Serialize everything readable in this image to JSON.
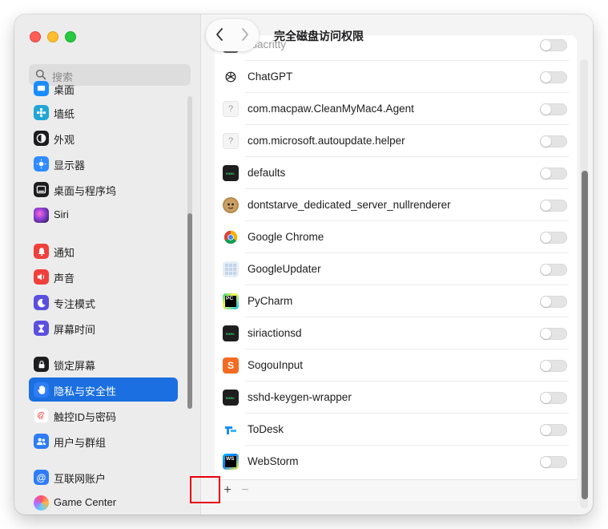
{
  "window": {
    "title": "完全磁盘访问权限"
  },
  "search": {
    "placeholder": "搜索"
  },
  "sidebar": {
    "items": [
      {
        "label": "桌面",
        "icon": "desktop-icon",
        "color": "#1a8cff"
      },
      {
        "label": "墙纸",
        "icon": "wallpaper-icon",
        "color": "#22a6d6"
      },
      {
        "label": "外观",
        "icon": "appearance-icon",
        "color": "#1d1d1f"
      },
      {
        "label": "显示器",
        "icon": "display-icon",
        "color": "#2f8bff"
      },
      {
        "label": "桌面与程序坞",
        "icon": "dock-icon",
        "color": "#1d1d1f"
      },
      {
        "label": "Siri",
        "icon": "siri-icon",
        "color": "#8a3ed6"
      },
      {
        "label": "通知",
        "icon": "bell-icon",
        "color": "#f0403b"
      },
      {
        "label": "声音",
        "icon": "sound-icon",
        "color": "#f0403b"
      },
      {
        "label": "专注模式",
        "icon": "moon-icon",
        "color": "#5b4fe0"
      },
      {
        "label": "屏幕时间",
        "icon": "hourglass-icon",
        "color": "#5b4fe0"
      },
      {
        "label": "锁定屏幕",
        "icon": "lock-screen-icon",
        "color": "#1d1d1f"
      },
      {
        "label": "隐私与安全性",
        "icon": "hand-icon",
        "color": "#2e7cf6"
      },
      {
        "label": "触控ID与密码",
        "icon": "fingerprint-icon",
        "color": "#ffffff"
      },
      {
        "label": "用户与群组",
        "icon": "users-icon",
        "color": "#2e7cf6"
      },
      {
        "label": "互联网账户",
        "icon": "at-icon",
        "color": "#2e7cf6"
      },
      {
        "label": "Game Center",
        "icon": "game-center-icon",
        "color": "#ff6f61"
      }
    ],
    "selected_index": 11
  },
  "apps": [
    {
      "name": "Alacritty",
      "icon": "alacritty-icon",
      "color": "#5c5c5c",
      "enabled": false
    },
    {
      "name": "ChatGPT",
      "icon": "chatgpt-icon",
      "color": "#ffffff",
      "enabled": false
    },
    {
      "name": "com.macpaw.CleanMyMac4.Agent",
      "icon": "generic-file-icon",
      "color": "#f4f4f4",
      "enabled": false
    },
    {
      "name": "com.microsoft.autoupdate.helper",
      "icon": "generic-file-icon",
      "color": "#f4f4f4",
      "enabled": false
    },
    {
      "name": "defaults",
      "icon": "terminal-icon",
      "color": "#1e1e1e",
      "enabled": false
    },
    {
      "name": "dontstarve_dedicated_server_nullrenderer",
      "icon": "dontstarve-icon",
      "color": "#b58a4a",
      "enabled": false
    },
    {
      "name": "Google Chrome",
      "icon": "chrome-icon",
      "color": "#ffffff",
      "enabled": false
    },
    {
      "name": "GoogleUpdater",
      "icon": "google-updater-icon",
      "color": "#e6eef8",
      "enabled": false
    },
    {
      "name": "PyCharm",
      "icon": "pycharm-icon",
      "color": "#1e1e1e",
      "enabled": false
    },
    {
      "name": "siriactionsd",
      "icon": "terminal-icon",
      "color": "#1e1e1e",
      "enabled": false
    },
    {
      "name": "SogouInput",
      "icon": "sogou-icon",
      "color": "#f36b21",
      "enabled": false
    },
    {
      "name": "sshd-keygen-wrapper",
      "icon": "terminal-icon",
      "color": "#1e1e1e",
      "enabled": false
    },
    {
      "name": "ToDesk",
      "icon": "todesk-icon",
      "color": "#ffffff",
      "enabled": false
    },
    {
      "name": "WebStorm",
      "icon": "webstorm-icon",
      "color": "#1e1e1e",
      "enabled": false
    }
  ],
  "footer": {
    "add_label": "+",
    "remove_label": "−"
  }
}
